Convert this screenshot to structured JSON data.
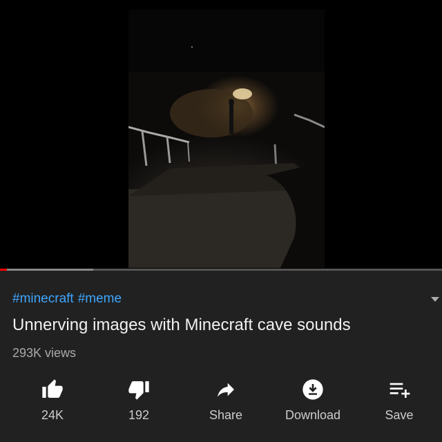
{
  "video": {
    "tags": [
      "#minecraft",
      "#meme"
    ],
    "title": "Unnerving images with Minecraft cave sounds",
    "views": "293K views",
    "progress": 0.015,
    "buffered": 0.21
  },
  "actions": [
    {
      "id": "like",
      "label": "24K",
      "icon": "thumbs-up-icon"
    },
    {
      "id": "dislike",
      "label": "192",
      "icon": "thumbs-down-icon"
    },
    {
      "id": "share",
      "label": "Share",
      "icon": "share-arrow-icon"
    },
    {
      "id": "download",
      "label": "Download",
      "icon": "download-icon"
    },
    {
      "id": "save",
      "label": "Save",
      "icon": "add-to-playlist-icon"
    }
  ],
  "colors": {
    "background": "#212121",
    "link": "#3ea6ff",
    "progress": "#ff0000"
  }
}
